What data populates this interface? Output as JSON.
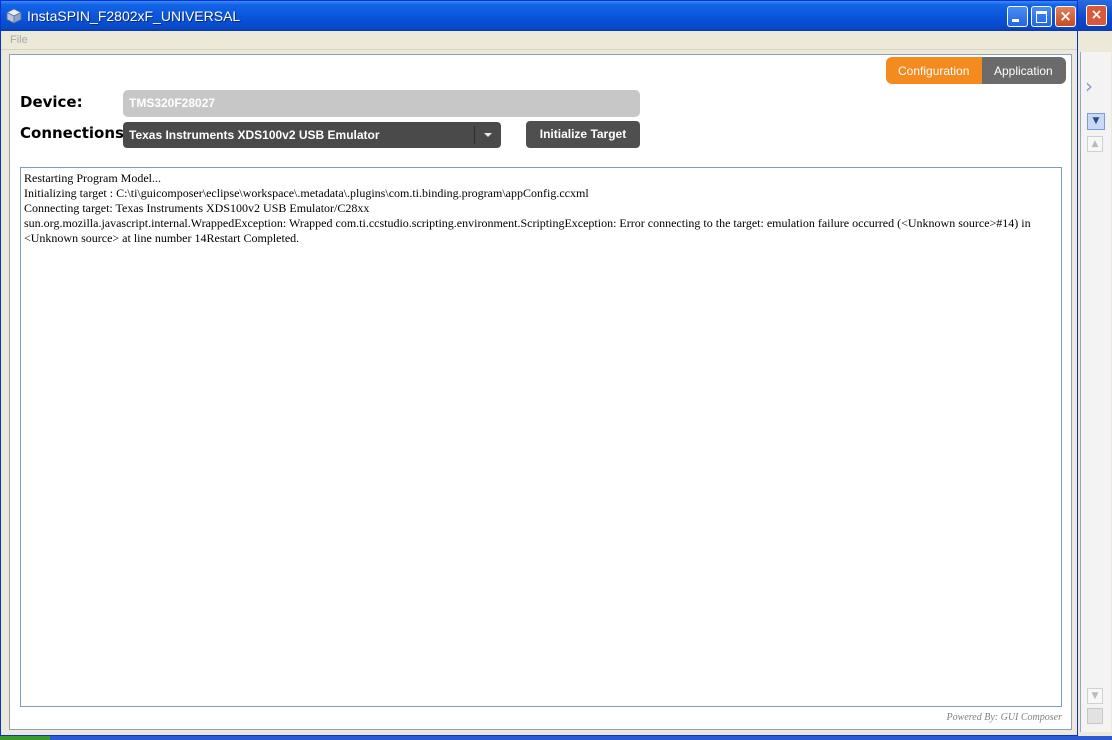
{
  "window": {
    "title": "InstaSPIN_F2802xF_UNIVERSAL",
    "controls": {
      "minimize": "minimize",
      "maximize": "maximize",
      "close": "×"
    }
  },
  "menu": {
    "file": "File"
  },
  "tabs": {
    "configuration": "Configuration",
    "application": "Application",
    "active": "configuration"
  },
  "form": {
    "device_label": "Device:",
    "device_value": "TMS320F28027",
    "connections_label": "Connections:",
    "connection_value": "Texas Instruments XDS100v2 USB Emulator",
    "initialize_label": "Initialize Target"
  },
  "log": {
    "lines": [
      "Restarting Program Model...",
      "Initializing target : C:\\ti\\guicomposer\\eclipse\\workspace\\.metadata\\.plugins\\com.ti.binding.program\\appConfig.ccxml",
      "Connecting target: Texas Instruments XDS100v2 USB Emulator/C28xx",
      "sun.org.mozilla.javascript.internal.WrappedException: Wrapped com.ti.ccstudio.scripting.environment.ScriptingException: Error connecting to the target: emulation failure occurred (<Unknown source>#14) in <Unknown source> at line number 14Restart Completed."
    ]
  },
  "footer": {
    "powered_by": "Powered By: GUI Composer"
  },
  "colors": {
    "titlebar": "#0a55dc",
    "accent_active_tab": "#f58a1f",
    "inactive_tab": "#6b6b6b",
    "dark_control": "#4a4a4a",
    "disabled_field": "#c7c7c7"
  },
  "icons": {
    "app": "cube-icon",
    "background_close": "close-icon",
    "background_chevron": "chevron-right-icon",
    "background_dropdown": "chevron-down-icon"
  }
}
